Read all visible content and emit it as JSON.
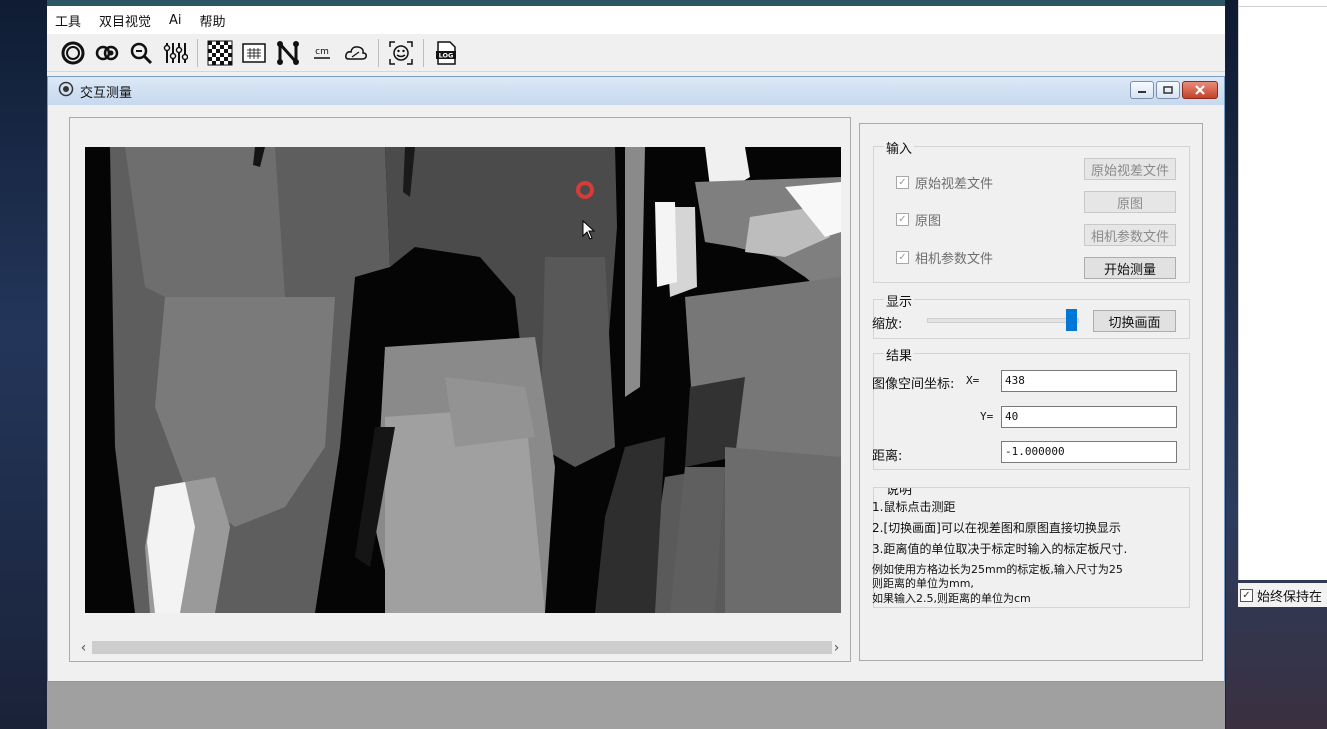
{
  "menu": {
    "items": [
      "工具",
      "双目视觉",
      "Ai",
      "帮助"
    ]
  },
  "toolbar": {
    "icons": [
      "ring-icon",
      "stereo-icon",
      "zoom-icon",
      "sliders-icon",
      "checkerboard-icon",
      "grid-icon",
      "graph-icon",
      "cm-icon",
      "cloud-icon",
      "face-icon",
      "log-icon"
    ],
    "cm_label": "cm",
    "log_label": "LOG"
  },
  "window": {
    "title": "交互测量"
  },
  "input_group": {
    "legend": "输入",
    "chk_disparity": "原始视差文件",
    "chk_original": "原图",
    "chk_camera": "相机参数文件",
    "btn_disparity": "原始视差文件",
    "btn_original": "原图",
    "btn_camera": "相机参数文件",
    "btn_start": "开始测量"
  },
  "display_group": {
    "legend": "显示",
    "zoom_label": "缩放:",
    "zoom_value": 1.0,
    "switch_button": "切换画面"
  },
  "result_group": {
    "legend": "结果",
    "coord_label": "图像空间坐标:",
    "x_label": "X=",
    "x_value": "438",
    "y_label": "Y=",
    "y_value": "40",
    "dist_label": "距离:",
    "dist_value": "-1.000000"
  },
  "notes_group": {
    "legend": "说明",
    "lines": [
      "1.鼠标点击测距",
      "2.[切换画面]可以在视差图和原图直接切换显示",
      "3.距离值的单位取决于标定时输入的标定板尺寸.",
      "例如使用方格边长为25mm的标定板,输入尺寸为25",
      "则距离的单位为mm,",
      "如果输入2.5,则距离的单位为cm"
    ]
  },
  "side": {
    "always_on_top": "始终保持在"
  },
  "colors": {
    "accent": "#0078d7",
    "marker": "#d83a3a"
  }
}
